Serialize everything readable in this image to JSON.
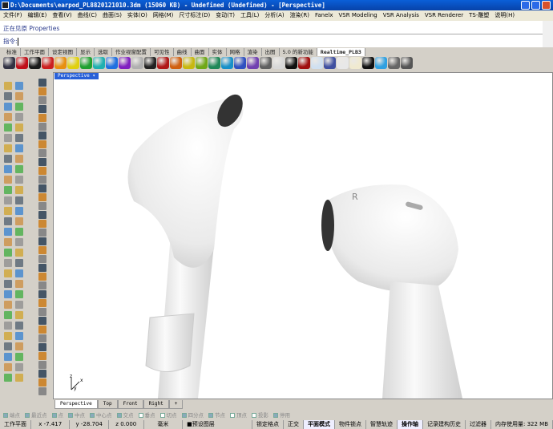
{
  "title": "D:\\Documents\\earpod_PL8820121010.3dm (15060 KB) - Undefined (Undefined) - [Perspective]",
  "menu": [
    "文件(F)",
    "编辑(E)",
    "查看(V)",
    "曲线(C)",
    "曲面(S)",
    "实体(O)",
    "网格(M)",
    "尺寸标注(D)",
    "变动(T)",
    "工具(L)",
    "分析(A)",
    "渲染(R)",
    "Fanelx",
    "VSR Modeling",
    "VSR Analysis",
    "VSR Renderer",
    "TS-雕塑",
    "说明(H)"
  ],
  "command": {
    "history": "正在见原 Properties",
    "prompt": "指令:"
  },
  "toolbar_tabs": [
    "标准",
    "工作平面",
    "设定视图",
    "显示",
    "选取",
    "作业视窗配置",
    "可见性",
    "曲线",
    "曲面",
    "实体",
    "网格",
    "渲染",
    "出图",
    "5.0 的新功能",
    "Realtime_PLB3"
  ],
  "active_toolbar_tab": "Realtime_PLB3",
  "swatch_colors": [
    "#334",
    "#c0101a",
    "#1a1a1a",
    "#cc2020",
    "#e89010",
    "#e0d010",
    "#20a030",
    "#20b0b0",
    "#2070e0",
    "#8020c0",
    "#b0b0b0",
    "#222",
    "#b01818",
    "#d06010",
    "#c8b810",
    "#70a818",
    "#208858",
    "#1890c8",
    "#3050c0",
    "#7040b0",
    "#606060",
    "#d8d8d8",
    "#101010",
    "#a01010",
    "#d0e0f0",
    "#4050a0",
    "#e8e8e8",
    "#f0ead0",
    "#111",
    "#30a0e0",
    "#666",
    "#555"
  ],
  "viewport": {
    "label": "Perspective",
    "earbud_letter": "R"
  },
  "viewport_tabs": [
    "Perspective",
    "Top",
    "Front",
    "Right",
    "+"
  ],
  "osnaps": [
    {
      "label": "端点",
      "on": true
    },
    {
      "label": "最近点",
      "on": true
    },
    {
      "label": "点",
      "on": true
    },
    {
      "label": "中点",
      "on": true
    },
    {
      "label": "中心点",
      "on": true
    },
    {
      "label": "交点",
      "on": true
    },
    {
      "label": "垂点",
      "on": false
    },
    {
      "label": "切点",
      "on": false
    },
    {
      "label": "四分点",
      "on": true
    },
    {
      "label": "节点",
      "on": true
    },
    {
      "label": "顶点",
      "on": false
    },
    {
      "label": "投影",
      "on": false
    },
    {
      "label": "停用",
      "on": true
    }
  ],
  "status": {
    "cplane": "工作平面",
    "x": "x -7.417",
    "y": "y -28.704",
    "z": "z 0.000",
    "units": "毫米",
    "layer": "预设图层",
    "items": [
      "锁定格点",
      "正交",
      "平面模式",
      "物件锁点",
      "智慧轨迹",
      "操作轴",
      "记录建构历史",
      "过滤器"
    ],
    "memory": "内存使用量: 322 MB"
  }
}
